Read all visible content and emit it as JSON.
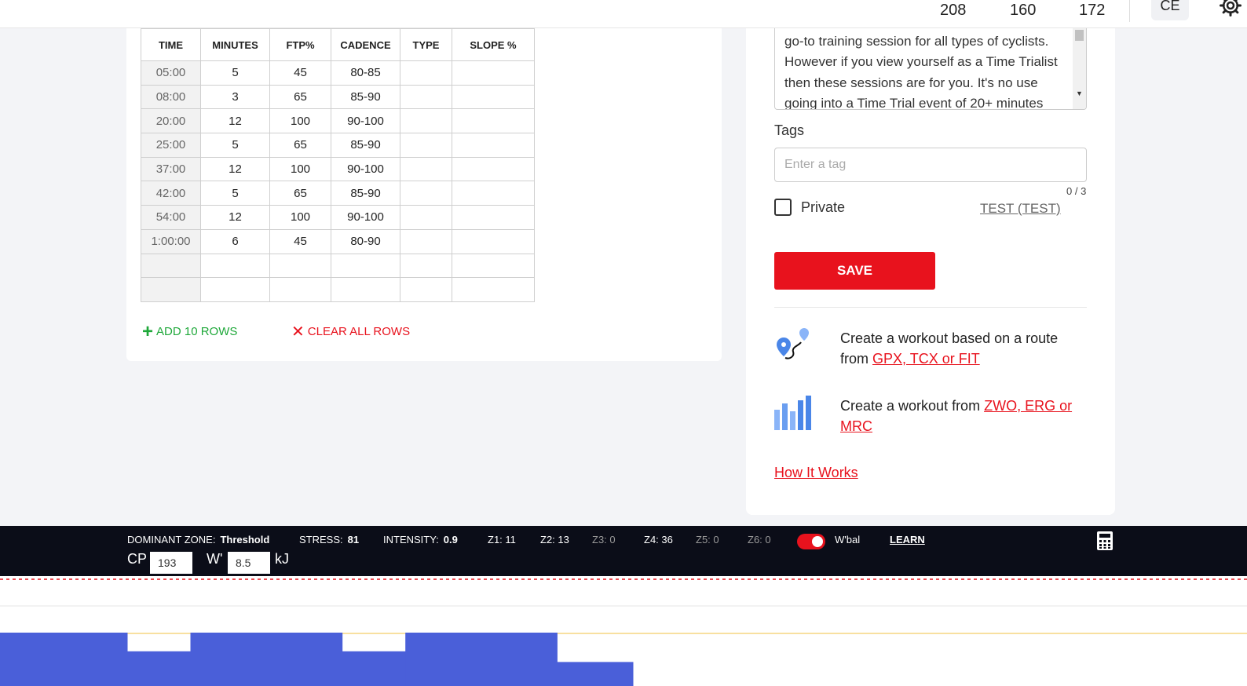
{
  "topbar": {
    "metrics": [
      "208",
      "160",
      "172"
    ],
    "avatar_initials": "CE",
    "gear_icon": "gear-icon"
  },
  "steps_table": {
    "headers": [
      "TIME",
      "MINUTES",
      "FTP%",
      "CADENCE",
      "TYPE",
      "SLOPE %"
    ],
    "rows": [
      [
        "05:00",
        "5",
        "45",
        "80-85",
        "",
        ""
      ],
      [
        "08:00",
        "3",
        "65",
        "85-90",
        "",
        ""
      ],
      [
        "20:00",
        "12",
        "100",
        "90-100",
        "",
        ""
      ],
      [
        "25:00",
        "5",
        "65",
        "85-90",
        "",
        ""
      ],
      [
        "37:00",
        "12",
        "100",
        "90-100",
        "",
        ""
      ],
      [
        "42:00",
        "5",
        "65",
        "85-90",
        "",
        ""
      ],
      [
        "54:00",
        "12",
        "100",
        "90-100",
        "",
        ""
      ],
      [
        "1:00:00",
        "6",
        "45",
        "80-90",
        "",
        ""
      ],
      [
        "",
        "",
        "",
        "",
        "",
        ""
      ],
      [
        "",
        "",
        "",
        "",
        "",
        ""
      ]
    ]
  },
  "row_actions": {
    "add_label": "ADD 10 ROWS",
    "clear_label": "CLEAR ALL ROWS"
  },
  "side_panel": {
    "description": "go-to training session for all types of cyclists. However if you view yourself as a Time Trialist then these sessions are for you. It's no use going into a Time Trial event of 20+ minutes",
    "tags_label": "Tags",
    "tags_placeholder": "Enter a tag",
    "tags_count": "0 / 3",
    "private_label": "Private",
    "test_link": "TEST (TEST)",
    "save_label": "SAVE",
    "route_text": "Create a workout based on a route from ",
    "route_link": "GPX, TCX or FIT",
    "file_text": "Create a workout from ",
    "file_link": "ZWO, ERG or MRC",
    "how_it_works": "How It Works"
  },
  "status_bar": {
    "dominant_label": "DOMINANT ZONE:",
    "dominant_value": "Threshold",
    "stress_label": "STRESS:",
    "stress_value": "81",
    "intensity_label": "INTENSITY:",
    "intensity_value": "0.9",
    "zones": [
      "Z1: 11",
      "Z2: 13",
      "Z3: 0",
      "Z4: 36",
      "Z5: 0",
      "Z6: 0"
    ],
    "wbal_label": "W'bal",
    "wbal_enabled": true,
    "learn_label": "LEARN",
    "cp_label": "CP",
    "cp_value": "193",
    "w_label": "W'",
    "w_value": "8.5",
    "kj_label": "kJ"
  },
  "colors": {
    "accent": "#e8121d",
    "green": "#1fa83a",
    "bar": "#4a5fd9",
    "statusbar_bg": "#0b0d18"
  },
  "workout_profile": {
    "segments": [
      {
        "minutes": 5,
        "ftp_pct": 45
      },
      {
        "minutes": 3,
        "ftp_pct": 65
      },
      {
        "minutes": 12,
        "ftp_pct": 100
      },
      {
        "minutes": 5,
        "ftp_pct": 65
      },
      {
        "minutes": 12,
        "ftp_pct": 100
      },
      {
        "minutes": 5,
        "ftp_pct": 65
      },
      {
        "minutes": 12,
        "ftp_pct": 100
      },
      {
        "minutes": 6,
        "ftp_pct": 45
      }
    ]
  }
}
